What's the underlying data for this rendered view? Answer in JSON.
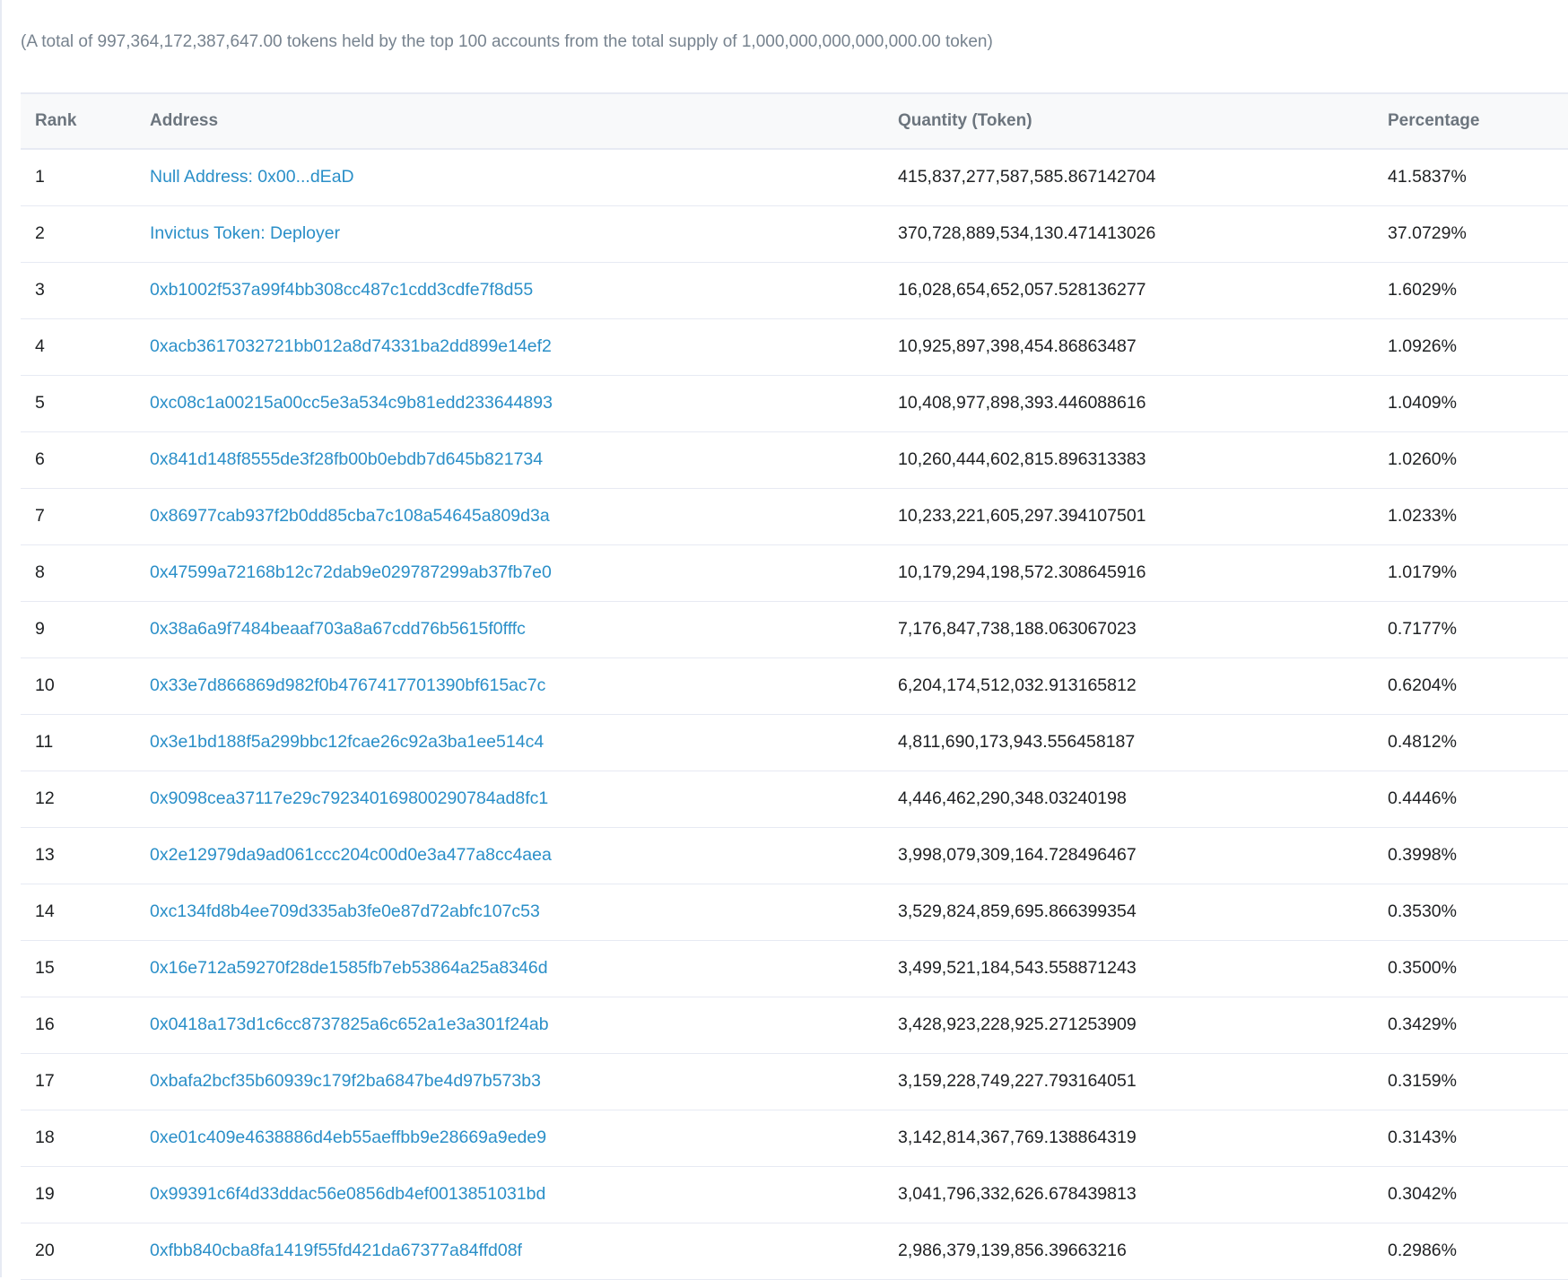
{
  "summary": {
    "prefix": "(A total of ",
    "total": "997,364,172,387,647.00",
    "middle": " tokens held by the top 100 accounts from the total supply of ",
    "supply": "1,000,000,000,000,000.00",
    "suffix": " token)"
  },
  "colors": {
    "link": "#2a8fc8",
    "header_bg": "#f8f9fa",
    "muted_text": "#77838f",
    "border": "#e7eaf3"
  },
  "table": {
    "headers": {
      "rank": "Rank",
      "address": "Address",
      "quantity": "Quantity (Token)",
      "percentage": "Percentage"
    },
    "rows": [
      {
        "rank": "1",
        "address": "Null Address: 0x00...dEaD",
        "quantity": "415,837,277,587,585.867142704",
        "percentage": "41.5837%"
      },
      {
        "rank": "2",
        "address": "Invictus Token: Deployer",
        "quantity": "370,728,889,534,130.471413026",
        "percentage": "37.0729%"
      },
      {
        "rank": "3",
        "address": "0xb1002f537a99f4bb308cc487c1cdd3cdfe7f8d55",
        "quantity": "16,028,654,652,057.528136277",
        "percentage": "1.6029%"
      },
      {
        "rank": "4",
        "address": "0xacb3617032721bb012a8d74331ba2dd899e14ef2",
        "quantity": "10,925,897,398,454.86863487",
        "percentage": "1.0926%"
      },
      {
        "rank": "5",
        "address": "0xc08c1a00215a00cc5e3a534c9b81edd233644893",
        "quantity": "10,408,977,898,393.446088616",
        "percentage": "1.0409%"
      },
      {
        "rank": "6",
        "address": "0x841d148f8555de3f28fb00b0ebdb7d645b821734",
        "quantity": "10,260,444,602,815.896313383",
        "percentage": "1.0260%"
      },
      {
        "rank": "7",
        "address": "0x86977cab937f2b0dd85cba7c108a54645a809d3a",
        "quantity": "10,233,221,605,297.394107501",
        "percentage": "1.0233%"
      },
      {
        "rank": "8",
        "address": "0x47599a72168b12c72dab9e029787299ab37fb7e0",
        "quantity": "10,179,294,198,572.308645916",
        "percentage": "1.0179%"
      },
      {
        "rank": "9",
        "address": "0x38a6a9f7484beaaf703a8a67cdd76b5615f0fffc",
        "quantity": "7,176,847,738,188.063067023",
        "percentage": "0.7177%"
      },
      {
        "rank": "10",
        "address": "0x33e7d866869d982f0b4767417701390bf615ac7c",
        "quantity": "6,204,174,512,032.913165812",
        "percentage": "0.6204%"
      },
      {
        "rank": "11",
        "address": "0x3e1bd188f5a299bbc12fcae26c92a3ba1ee514c4",
        "quantity": "4,811,690,173,943.556458187",
        "percentage": "0.4812%"
      },
      {
        "rank": "12",
        "address": "0x9098cea37117e29c792340169800290784ad8fc1",
        "quantity": "4,446,462,290,348.03240198",
        "percentage": "0.4446%"
      },
      {
        "rank": "13",
        "address": "0x2e12979da9ad061ccc204c00d0e3a477a8cc4aea",
        "quantity": "3,998,079,309,164.728496467",
        "percentage": "0.3998%"
      },
      {
        "rank": "14",
        "address": "0xc134fd8b4ee709d335ab3fe0e87d72abfc107c53",
        "quantity": "3,529,824,859,695.866399354",
        "percentage": "0.3530%"
      },
      {
        "rank": "15",
        "address": "0x16e712a59270f28de1585fb7eb53864a25a8346d",
        "quantity": "3,499,521,184,543.558871243",
        "percentage": "0.3500%"
      },
      {
        "rank": "16",
        "address": "0x0418a173d1c6cc8737825a6c652a1e3a301f24ab",
        "quantity": "3,428,923,228,925.271253909",
        "percentage": "0.3429%"
      },
      {
        "rank": "17",
        "address": "0xbafa2bcf35b60939c179f2ba6847be4d97b573b3",
        "quantity": "3,159,228,749,227.793164051",
        "percentage": "0.3159%"
      },
      {
        "rank": "18",
        "address": "0xe01c409e4638886d4eb55aeffbb9e28669a9ede9",
        "quantity": "3,142,814,367,769.138864319",
        "percentage": "0.3143%"
      },
      {
        "rank": "19",
        "address": "0x99391c6f4d33ddac56e0856db4ef0013851031bd",
        "quantity": "3,041,796,332,626.678439813",
        "percentage": "0.3042%"
      },
      {
        "rank": "20",
        "address": "0xfbb840cba8fa1419f55fd421da67377a84ffd08f",
        "quantity": "2,986,379,139,856.39663216",
        "percentage": "0.2986%"
      }
    ]
  }
}
